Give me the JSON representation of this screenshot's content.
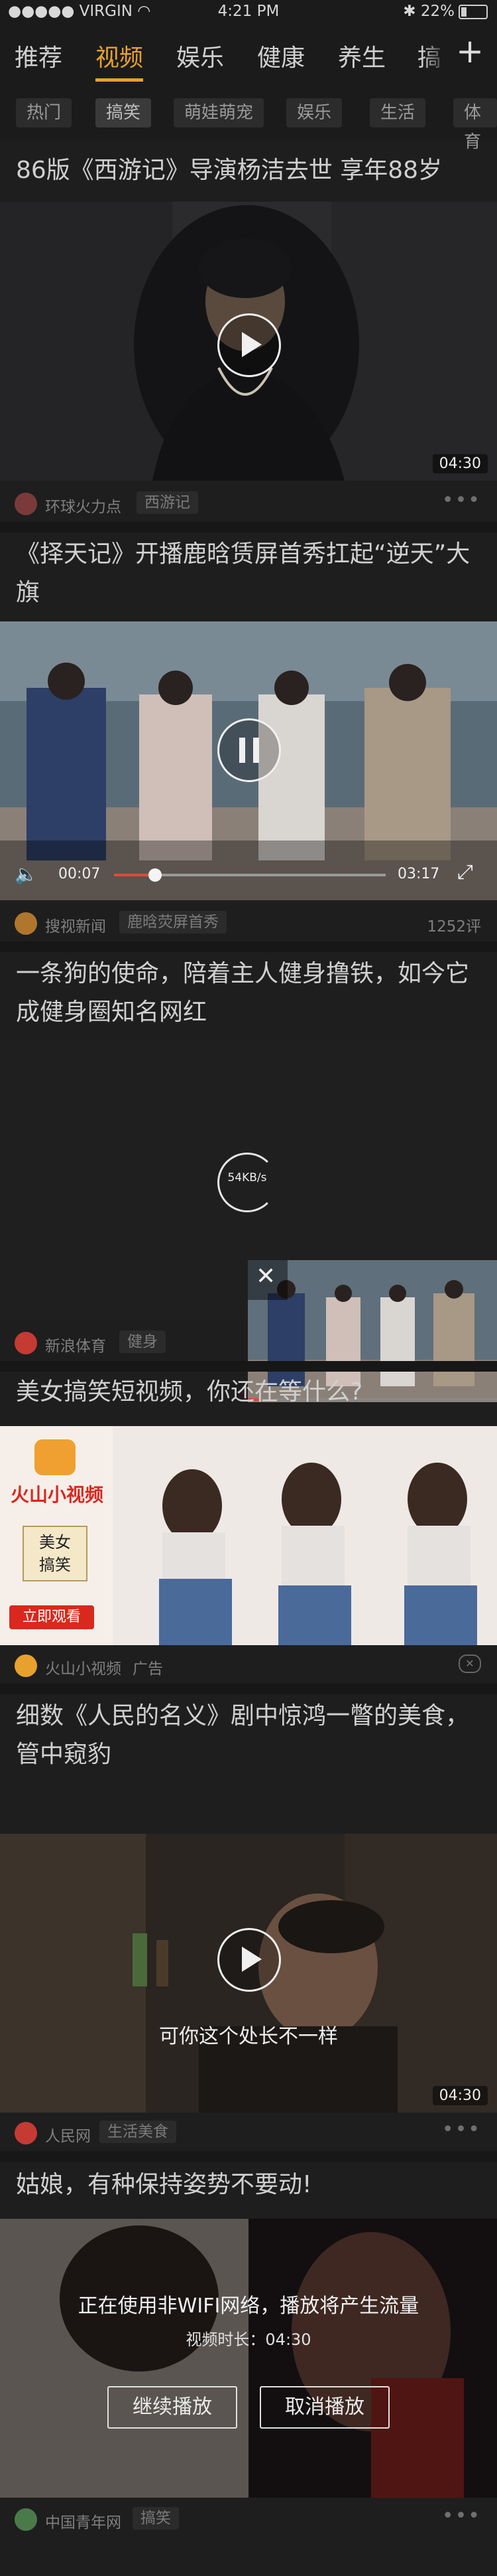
{
  "status_bar": {
    "carrier": "VIRGIN",
    "time": "4:21 PM",
    "battery": "22%"
  },
  "nav": {
    "tabs": [
      "推荐",
      "视频",
      "娱乐",
      "健康",
      "养生",
      "搞"
    ],
    "active_index": 1,
    "plus": "+"
  },
  "chips": [
    "热门",
    "搞笑",
    "萌娃萌宠",
    "娱乐",
    "生活",
    "体育"
  ],
  "feed": [
    {
      "title": "86版《西游记》导演杨洁去世 享年88岁",
      "duration": "04:30",
      "source": "环球火力点",
      "tag": "西游记"
    },
    {
      "title": "《择天记》开播鹿晗赁屏首秀扛起“逆天”大旗",
      "player": {
        "elapsed": "00:07",
        "total": "03:17",
        "progress": 0.04
      },
      "source": "搜视新闻",
      "tag": "鹿晗荧屏首秀",
      "comments": "1252评"
    },
    {
      "title": "一条狗的使命，陪着主人健身撸铁，如今它成健身圈知名网红",
      "loading": "54KB/s",
      "source": "新浪体育",
      "tag": "健身"
    },
    {
      "title": "美女搞笑短视频，你还在等什么?",
      "ad": {
        "brand": "火山小视频",
        "tag_text": "美女\n搞笑",
        "cta": "立即观看"
      },
      "source": "火山小视频",
      "tag": "广告"
    },
    {
      "title": "细数《人民的名义》剧中惊鸿一瞥的美食，管中窥豹",
      "subtitle": "可你这个处长不一样",
      "duration": "04:30",
      "source": "人民网",
      "tag": "生活美食"
    },
    {
      "title": "姑娘，有种保持姿势不要动!",
      "notice": {
        "message": "正在使用非WIFI网络，播放将产生流量",
        "length_label": "视频时长：04:30",
        "continue": "继续播放",
        "cancel": "取消播放"
      },
      "source": "中国青年网",
      "tag": "搞笑"
    }
  ],
  "colors": {
    "accent": "#e8a12c",
    "bg": "#1e1e1f"
  }
}
